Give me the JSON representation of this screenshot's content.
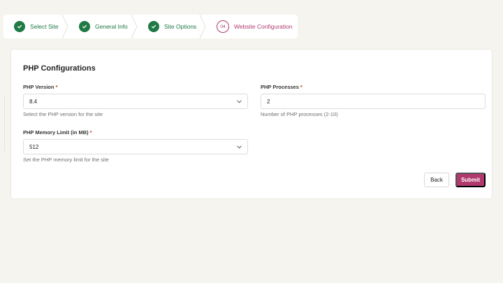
{
  "stepper": {
    "steps": [
      {
        "label": "Select Site",
        "status": "completed"
      },
      {
        "label": "General Info",
        "status": "completed"
      },
      {
        "label": "Site Options",
        "status": "completed"
      },
      {
        "label": "Website Configuration",
        "status": "active",
        "number": "04"
      }
    ]
  },
  "form": {
    "section_title": "PHP Configurations",
    "php_version": {
      "label": "PHP Version",
      "required_mark": "*",
      "value": "8.4",
      "help": "Select the PHP version for the site"
    },
    "php_processes": {
      "label": "PHP Processes",
      "required_mark": "*",
      "value": "2",
      "help": "Number of PHP processes (2-10)"
    },
    "php_memory_limit": {
      "label": "PHP Memory Limit (in MB)",
      "required_mark": "*",
      "value": "512",
      "help": "Set the PHP memory limit for the site"
    }
  },
  "actions": {
    "back_label": "Back",
    "submit_label": "Submit"
  },
  "colors": {
    "completed": "#1f7a45",
    "active": "#b03a6e",
    "background": "#f5f4ef"
  }
}
